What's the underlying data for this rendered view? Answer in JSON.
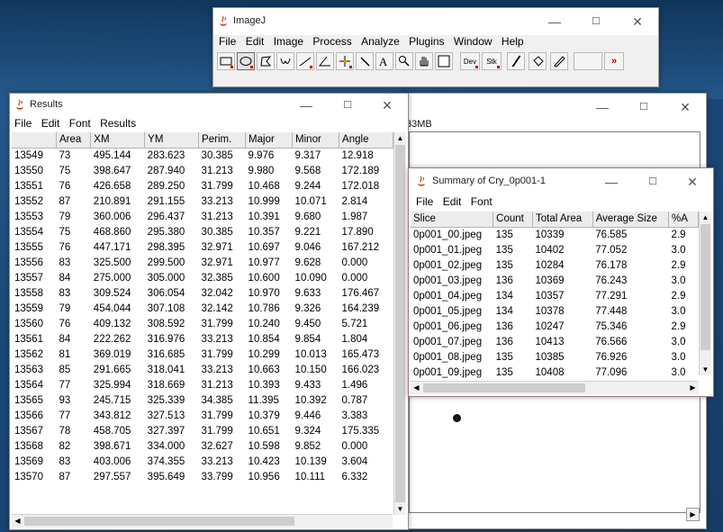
{
  "imagej": {
    "title": "ImageJ",
    "menu": [
      "File",
      "Edit",
      "Image",
      "Process",
      "Analyze",
      "Plugins",
      "Window",
      "Help"
    ],
    "tools": [
      "rectangle-tool",
      "oval-tool",
      "polygon-tool",
      "freehand-tool",
      "line-tool",
      "angle-tool",
      "point-tool",
      "wand-tool",
      "text-tool",
      "magnifier-tool",
      "hand-tool",
      "color-picker-tool",
      "dev-menu",
      "stk-menu",
      "brush-tool",
      "flood-fill-tool",
      "pencil-tool",
      "more-tools"
    ],
    "dev_label": "Dev",
    "stk_label": "Stk",
    "more_label": "»"
  },
  "bg_window": {
    "memory": "33MB"
  },
  "results": {
    "title": "Results",
    "menu": [
      "File",
      "Edit",
      "Font",
      "Results"
    ],
    "columns": [
      "",
      "Area",
      "XM",
      "YM",
      "Perim.",
      "Major",
      "Minor",
      "Angle"
    ],
    "rows": [
      [
        "13549",
        "73",
        "495.144",
        "283.623",
        "30.385",
        "9.976",
        "9.317",
        "12.918"
      ],
      [
        "13550",
        "75",
        "398.647",
        "287.940",
        "31.213",
        "9.980",
        "9.568",
        "172.189"
      ],
      [
        "13551",
        "76",
        "426.658",
        "289.250",
        "31.799",
        "10.468",
        "9.244",
        "172.018"
      ],
      [
        "13552",
        "87",
        "210.891",
        "291.155",
        "33.213",
        "10.999",
        "10.071",
        "2.814"
      ],
      [
        "13553",
        "79",
        "360.006",
        "296.437",
        "31.213",
        "10.391",
        "9.680",
        "1.987"
      ],
      [
        "13554",
        "75",
        "468.860",
        "295.380",
        "30.385",
        "10.357",
        "9.221",
        "17.890"
      ],
      [
        "13555",
        "76",
        "447.171",
        "298.395",
        "32.971",
        "10.697",
        "9.046",
        "167.212"
      ],
      [
        "13556",
        "83",
        "325.500",
        "299.500",
        "32.971",
        "10.977",
        "9.628",
        "0.000"
      ],
      [
        "13557",
        "84",
        "275.000",
        "305.000",
        "32.385",
        "10.600",
        "10.090",
        "0.000"
      ],
      [
        "13558",
        "83",
        "309.524",
        "306.054",
        "32.042",
        "10.970",
        "9.633",
        "176.467"
      ],
      [
        "13559",
        "79",
        "454.044",
        "307.108",
        "32.142",
        "10.786",
        "9.326",
        "164.239"
      ],
      [
        "13560",
        "76",
        "409.132",
        "308.592",
        "31.799",
        "10.240",
        "9.450",
        "5.721"
      ],
      [
        "13561",
        "84",
        "222.262",
        "316.976",
        "33.213",
        "10.854",
        "9.854",
        "1.804"
      ],
      [
        "13562",
        "81",
        "369.019",
        "316.685",
        "31.799",
        "10.299",
        "10.013",
        "165.473"
      ],
      [
        "13563",
        "85",
        "291.665",
        "318.041",
        "33.213",
        "10.663",
        "10.150",
        "166.023"
      ],
      [
        "13564",
        "77",
        "325.994",
        "318.669",
        "31.213",
        "10.393",
        "9.433",
        "1.496"
      ],
      [
        "13565",
        "93",
        "245.715",
        "325.339",
        "34.385",
        "11.395",
        "10.392",
        "0.787"
      ],
      [
        "13566",
        "77",
        "343.812",
        "327.513",
        "31.799",
        "10.379",
        "9.446",
        "3.383"
      ],
      [
        "13567",
        "78",
        "458.705",
        "327.397",
        "31.799",
        "10.651",
        "9.324",
        "175.335"
      ],
      [
        "13568",
        "82",
        "398.671",
        "334.000",
        "32.627",
        "10.598",
        "9.852",
        "0.000"
      ],
      [
        "13569",
        "83",
        "403.006",
        "374.355",
        "33.213",
        "10.423",
        "10.139",
        "3.604"
      ],
      [
        "13570",
        "87",
        "297.557",
        "395.649",
        "33.799",
        "10.956",
        "10.111",
        "6.332"
      ]
    ]
  },
  "summary": {
    "title": "Summary of Cry_0p001-1",
    "menu": [
      "File",
      "Edit",
      "Font"
    ],
    "columns": [
      "Slice",
      "Count",
      "Total Area",
      "Average Size",
      "%A"
    ],
    "rows": [
      [
        "0p001_00.jpeg",
        "135",
        "10339",
        "76.585",
        "2.9"
      ],
      [
        "0p001_01.jpeg",
        "135",
        "10402",
        "77.052",
        "3.0"
      ],
      [
        "0p001_02.jpeg",
        "135",
        "10284",
        "76.178",
        "2.9"
      ],
      [
        "0p001_03.jpeg",
        "136",
        "10369",
        "76.243",
        "3.0"
      ],
      [
        "0p001_04.jpeg",
        "134",
        "10357",
        "77.291",
        "2.9"
      ],
      [
        "0p001_05.jpeg",
        "134",
        "10378",
        "77.448",
        "3.0"
      ],
      [
        "0p001_06.jpeg",
        "136",
        "10247",
        "75.346",
        "2.9"
      ],
      [
        "0p001_07.jpeg",
        "136",
        "10413",
        "76.566",
        "3.0"
      ],
      [
        "0p001_08.jpeg",
        "135",
        "10385",
        "76.926",
        "3.0"
      ],
      [
        "0p001_09.jpeg",
        "135",
        "10408",
        "77.096",
        "3.0"
      ]
    ]
  },
  "window_controls": {
    "minimize": "—",
    "maximize": "☐",
    "close": "✕"
  }
}
